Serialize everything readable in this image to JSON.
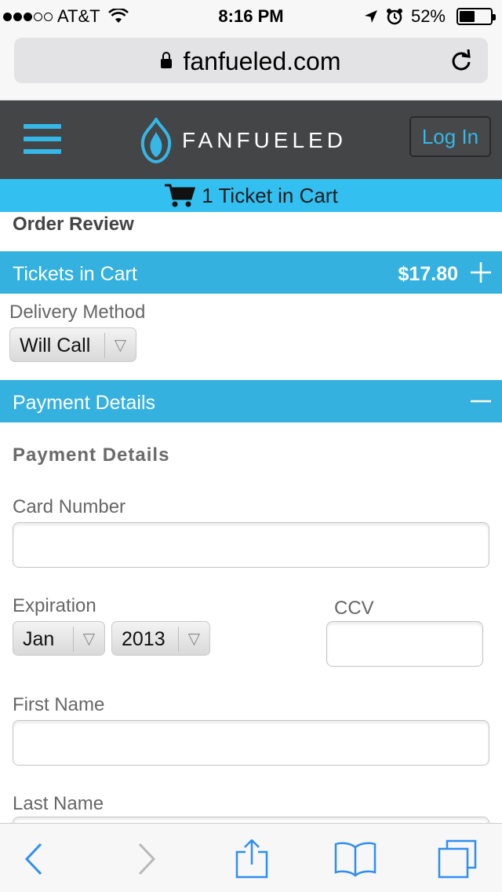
{
  "status_bar": {
    "carrier": "AT&T",
    "time": "8:16 PM",
    "battery": "52%",
    "battery_level": 0.52
  },
  "browser": {
    "url": "fanfueled.com"
  },
  "site_header": {
    "brand": "FANFUELED",
    "login_label": "Log In"
  },
  "cart_banner": {
    "text": "1 Ticket in Cart"
  },
  "order_review": {
    "title": "Order Review"
  },
  "tickets_section": {
    "title": "Tickets in Cart",
    "total": "$17.80"
  },
  "delivery": {
    "label": "Delivery Method",
    "selected": "Will Call"
  },
  "payment_section": {
    "title": "Payment Details"
  },
  "payment_form": {
    "heading": "Payment Details",
    "card_number_label": "Card Number",
    "card_number_value": "",
    "expiration_label": "Expiration",
    "exp_month": "Jan",
    "exp_year": "2013",
    "ccv_label": "CCV",
    "ccv_value": "",
    "first_name_label": "First Name",
    "first_name_value": "",
    "last_name_label": "Last Name"
  },
  "colors": {
    "accent": "#35b1e0",
    "header_bg": "#444546",
    "link": "#2f8ef5"
  }
}
